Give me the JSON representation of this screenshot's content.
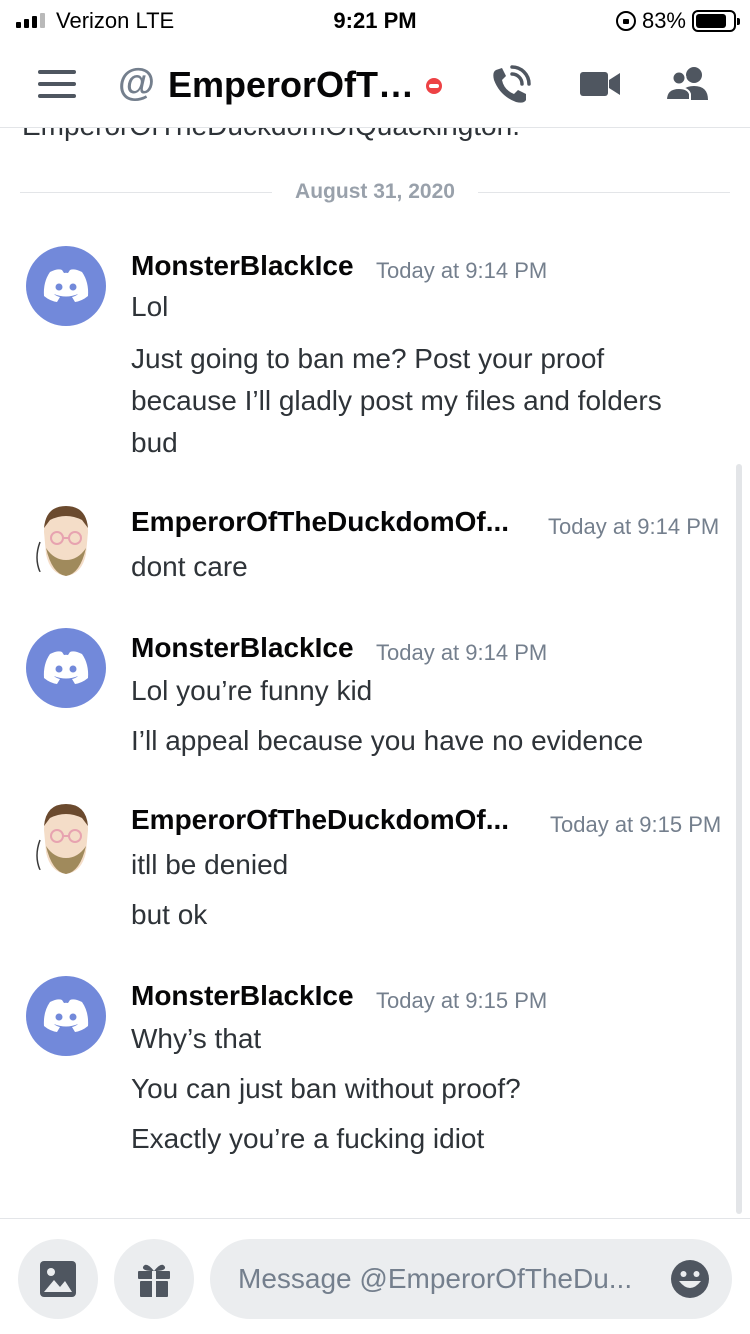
{
  "status_bar": {
    "carrier": "Verizon  LTE",
    "time": "9:21 PM",
    "battery_percent": "83%",
    "battery_level": 0.83
  },
  "header": {
    "at_symbol": "@",
    "title": "EmperorOfTh...",
    "status": "do-not-disturb"
  },
  "channel_intro_cutoff": "EmperorOfTheDuckdomOfQuackington.",
  "date_divider": "August 31, 2020",
  "messages": [
    {
      "author": "MonsterBlackIce",
      "timestamp": "Today at 9:14 PM",
      "lines": [
        "Lol",
        "Just going to ban me? Post your proof",
        "because I’ll gladly post my files and folders",
        "bud"
      ]
    },
    {
      "author": "EmperorOfTheDuckdomOf...",
      "timestamp": "Today at 9:14 PM",
      "lines": [
        "dont care"
      ]
    },
    {
      "author": "MonsterBlackIce",
      "timestamp": "Today at 9:14 PM",
      "lines": [
        "Lol you’re funny kid",
        "I’ll appeal because you have no evidence"
      ]
    },
    {
      "author": "EmperorOfTheDuckdomOf...",
      "timestamp": "Today at 9:15 PM",
      "lines": [
        "itll be denied",
        "but ok"
      ]
    },
    {
      "author": "MonsterBlackIce",
      "timestamp": "Today at 9:15 PM",
      "lines": [
        "Why’s that",
        "You can just ban without proof?",
        "Exactly you’re a fucking idiot"
      ]
    }
  ],
  "input": {
    "placeholder": "Message @EmperorOfTheDu..."
  },
  "colors": {
    "blurple": "#7289da",
    "dnd_red": "#ed4245",
    "muted_text": "#747f8d"
  },
  "icons": [
    "menu-icon",
    "phone-call-icon",
    "video-camera-icon",
    "members-icon",
    "image-icon",
    "gift-icon",
    "emoji-icon",
    "discord-logo-icon"
  ]
}
